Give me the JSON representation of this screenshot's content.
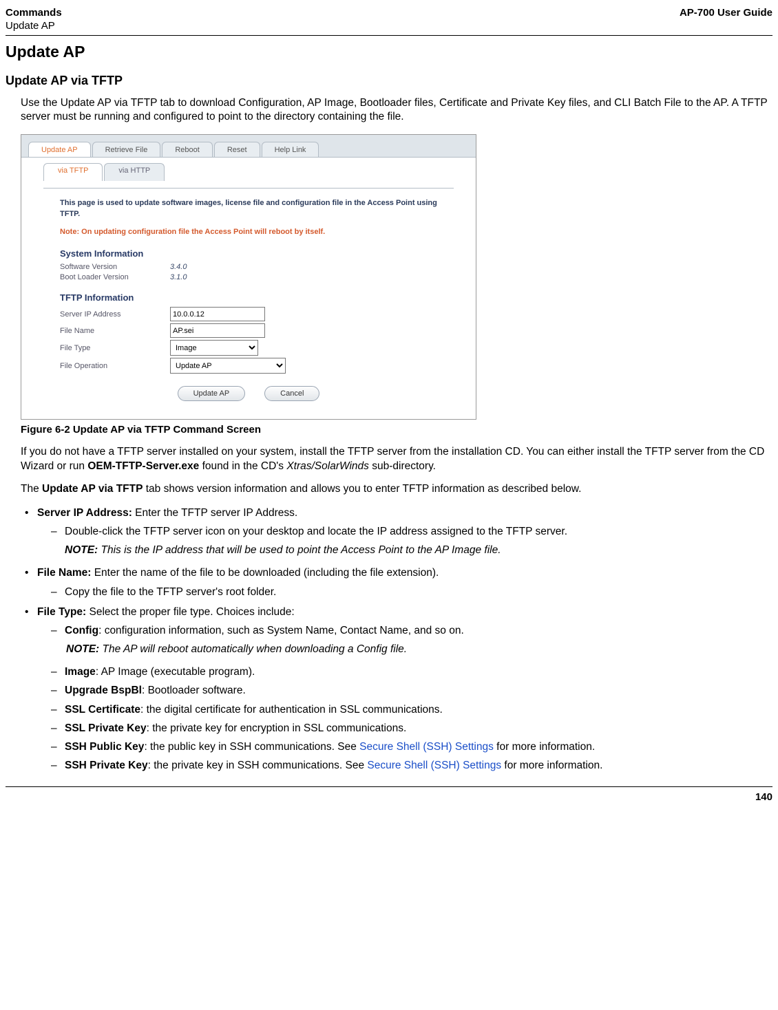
{
  "header": {
    "left_line1": "Commands",
    "left_line2": "Update AP",
    "right": "AP-700 User Guide"
  },
  "h1": "Update AP",
  "h2": "Update AP via TFTP",
  "intro": "Use the Update AP via TFTP tab to download Configuration, AP Image, Bootloader files, Certificate and Private Key files, and CLI Batch File to the AP. A TFTP server must be running and configured to point to the directory containing the file.",
  "ui": {
    "tabs": [
      "Update AP",
      "Retrieve File",
      "Reboot",
      "Reset",
      "Help Link"
    ],
    "subtabs": [
      "via TFTP",
      "via HTTP"
    ],
    "desc": "This page is used to update software images, license file and configuration file in the Access Point using TFTP.",
    "note": "Note: On updating configuration file the Access Point will reboot by itself.",
    "sys_title": "System Information",
    "sw_label": "Software Version",
    "sw_value": "3.4.0",
    "bl_label": "Boot Loader Version",
    "bl_value": "3.1.0",
    "tftp_title": "TFTP Information",
    "server_ip_label": "Server IP Address",
    "server_ip_value": "10.0.0.12",
    "file_name_label": "File Name",
    "file_name_value": "AP.sei",
    "file_type_label": "File Type",
    "file_type_value": "Image",
    "file_op_label": "File Operation",
    "file_op_value": "Update AP",
    "btn_update": "Update AP",
    "btn_cancel": "Cancel"
  },
  "figure_caption": "Figure 6-2 Update AP via TFTP Command Screen",
  "para1_a": "If you do not have a TFTP server installed on your system, install the TFTP server from the installation CD. You can either install the TFTP server from the CD Wizard or run ",
  "para1_b": "OEM-TFTP-Server.exe",
  "para1_c": " found in the CD's ",
  "para1_d": "Xtras/SolarWinds",
  "para1_e": " sub-directory.",
  "para2_a": "The ",
  "para2_b": "Update AP via TFTP",
  "para2_c": " tab shows version information and allows you to enter TFTP information as described below.",
  "b1_label": "Server IP Address:",
  "b1_text": " Enter the TFTP server IP Address.",
  "b1_sub": "Double-click the TFTP server icon on your desktop and locate the IP address assigned to the TFTP server.",
  "b1_note_label": "NOTE:",
  "b1_note_text": " This is the IP address that will be used to point the Access Point to the AP Image file.",
  "b2_label": "File Name:",
  "b2_text": " Enter the name of the file to be downloaded (including the file extension).",
  "b2_sub": "Copy the file to the TFTP server's root folder.",
  "b3_label": "File Type:",
  "b3_text": " Select the proper file type. Choices include:",
  "b3s1_label": "Config",
  "b3s1_text": ": configuration information, such as System Name, Contact Name, and so on.",
  "b3_note_label": "NOTE:",
  "b3_note_text": " The AP will reboot automatically when downloading a Config file.",
  "b3s2_label": "Image",
  "b3s2_text": ": AP Image (executable program).",
  "b3s3_label": "Upgrade BspBl",
  "b3s3_text": ": Bootloader software.",
  "b3s4_label": "SSL Certificate",
  "b3s4_text": ": the digital certificate for authentication in SSL communications.",
  "b3s5_label": "SSL Private Key",
  "b3s5_text": ": the private key for encryption in SSL communications.",
  "b3s6_label": "SSH Public Key",
  "b3s6_text": ": the public key in SSH communications. See ",
  "ssh_link": "Secure Shell (SSH) Settings",
  "b3s6_tail": " for more information.",
  "b3s7_label": "SSH Private Key",
  "b3s7_text": ": the private key in SSH communications. See ",
  "b3s7_tail": " for more information.",
  "page_number": "140"
}
